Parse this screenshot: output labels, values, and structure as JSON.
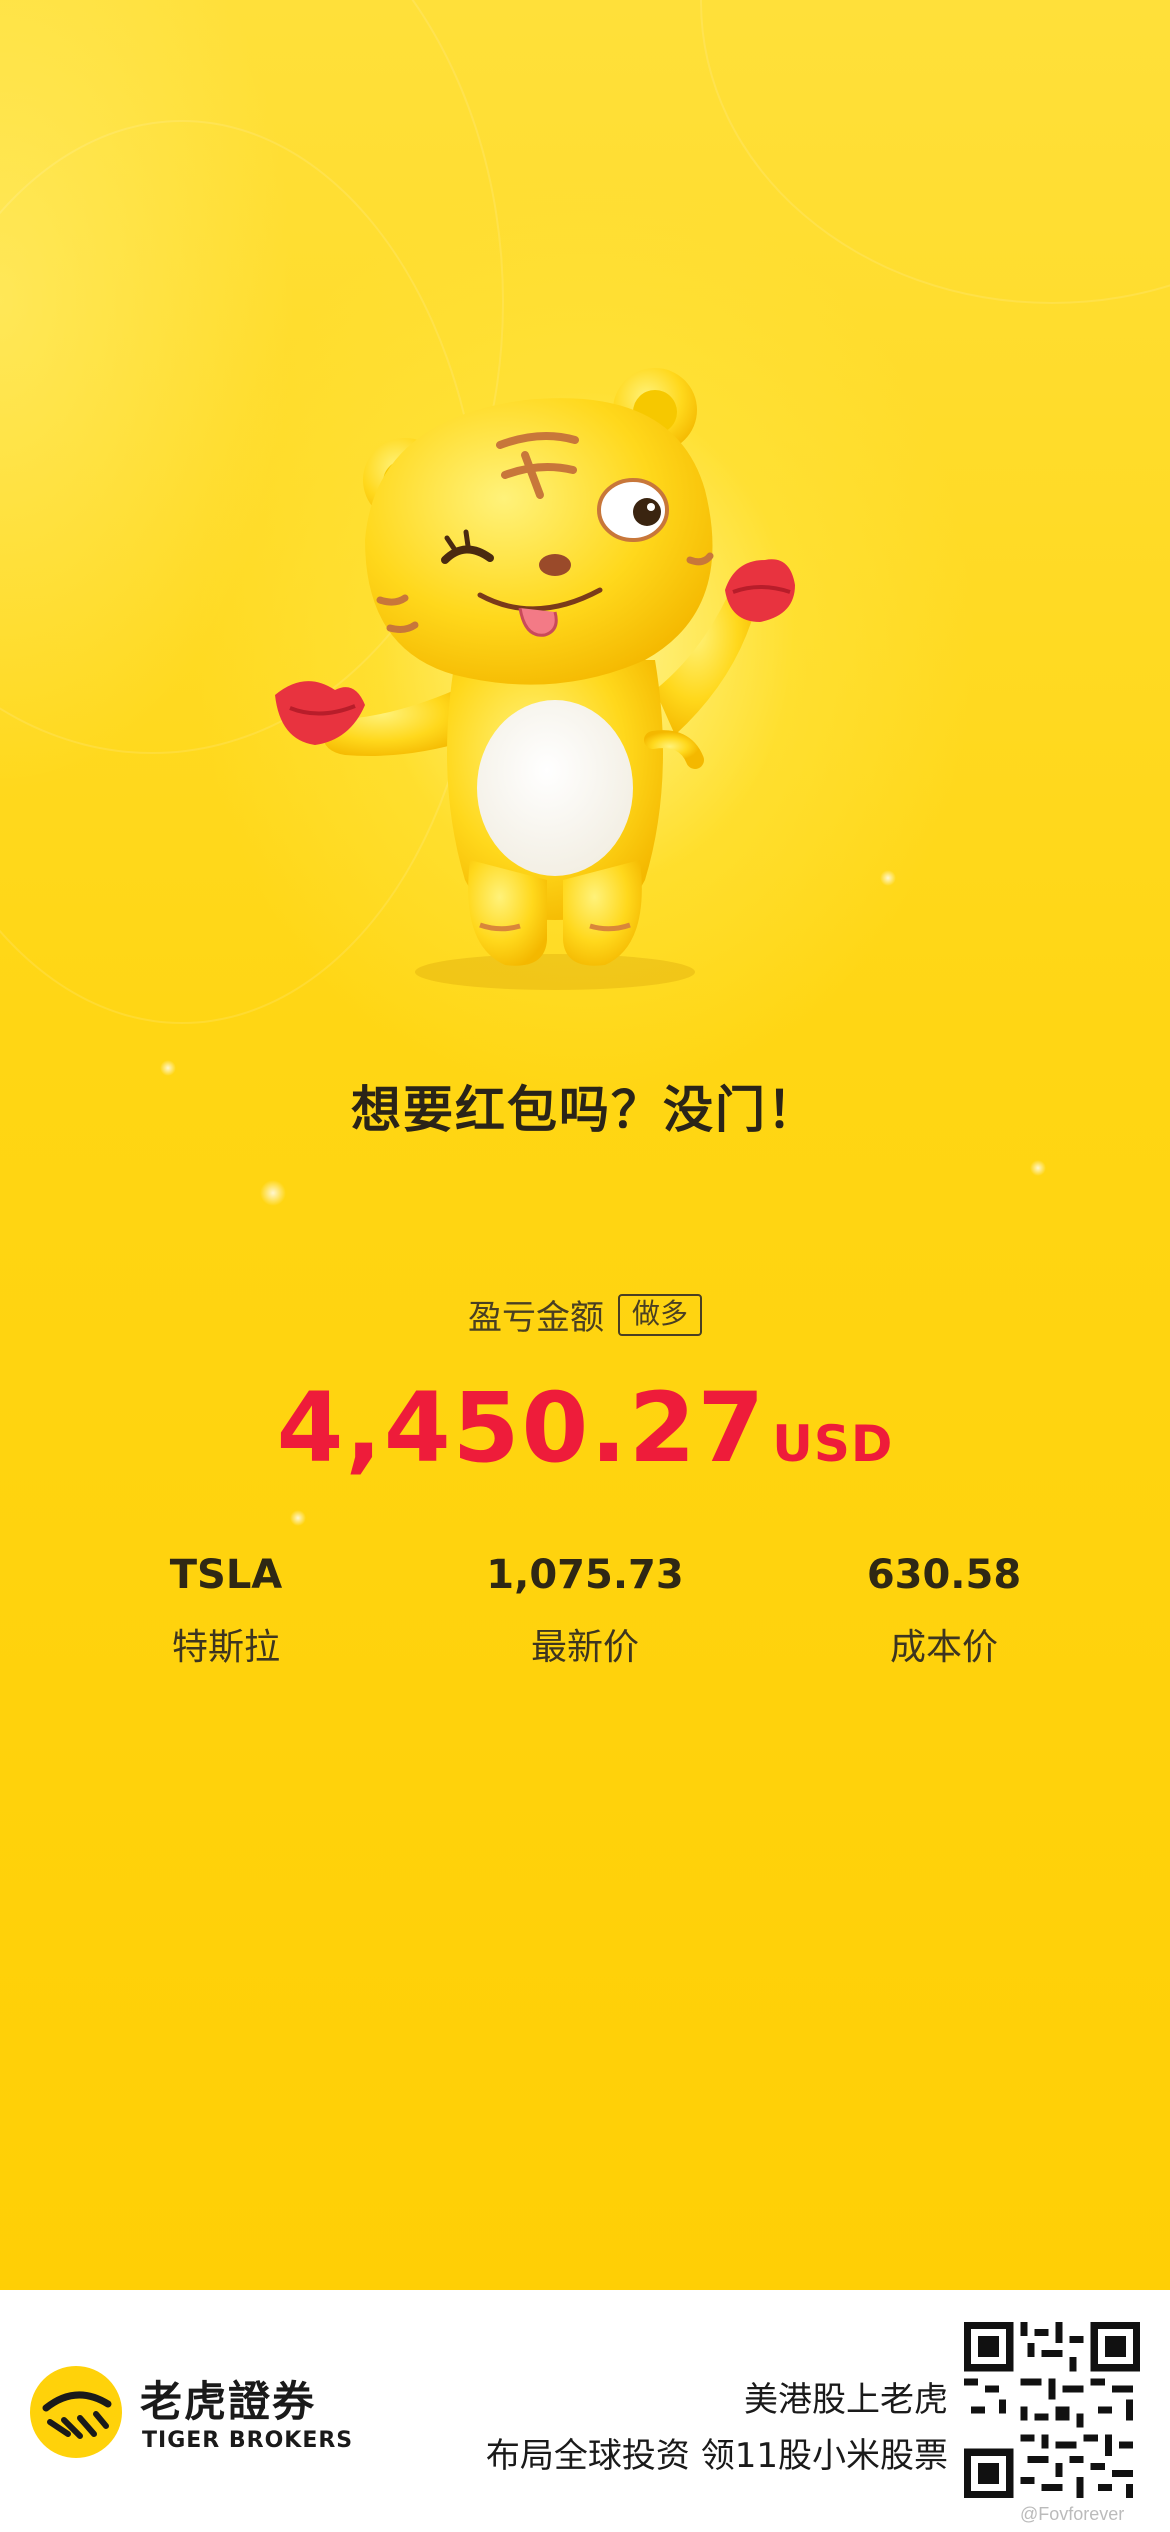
{
  "slogan": "想要红包吗？没门！",
  "pnl": {
    "label": "盈亏金额",
    "position_tag": "做多",
    "amount": "4,450.27",
    "currency": "USD"
  },
  "stock": {
    "ticker": "TSLA",
    "name": "特斯拉",
    "latest_price": "1,075.73",
    "latest_price_label": "最新价",
    "cost_price": "630.58",
    "cost_price_label": "成本价"
  },
  "footer": {
    "brand_cn": "老虎證券",
    "brand_en": "TIGER BROKERS",
    "promo_line1": "美港股上老虎",
    "promo_line2": "布局全球投资 领11股小米股票",
    "watermark": "@Fovforever"
  },
  "colors": {
    "background": "#ffd20a",
    "profit_red": "#ee1c3a",
    "footer_bg": "#ffffff"
  },
  "icons": [
    "tiger-mascot-icon",
    "tiger-brokers-logo-icon",
    "qr-code-icon"
  ]
}
